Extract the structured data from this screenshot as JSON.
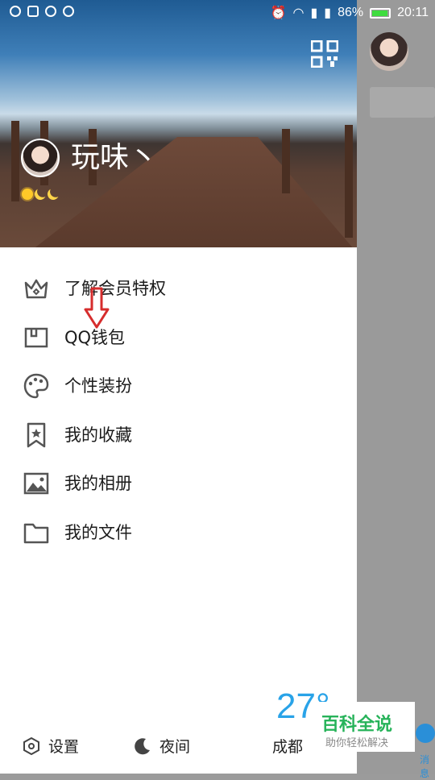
{
  "status_bar": {
    "battery": "86%",
    "time": "20:11",
    "battery_level": 0.86
  },
  "profile": {
    "nickname": "玩味丶"
  },
  "menu": {
    "items": [
      {
        "label": "了解会员特权",
        "icon": "crown-icon"
      },
      {
        "label": "QQ钱包",
        "icon": "wallet-icon"
      },
      {
        "label": "个性装扮",
        "icon": "palette-icon"
      },
      {
        "label": "我的收藏",
        "icon": "bookmark-star-icon"
      },
      {
        "label": "我的相册",
        "icon": "image-icon"
      },
      {
        "label": "我的文件",
        "icon": "folder-icon"
      }
    ]
  },
  "bottom_bar": {
    "settings": "设置",
    "night": "夜间",
    "city": "成都",
    "temperature": "27°"
  },
  "watermark": {
    "title": "百科全说",
    "subtitle": "助你轻松解决"
  },
  "behind": {
    "messages_label": "消息"
  },
  "colors": {
    "accent": "#29a3e8",
    "watermark_green": "#27b35a",
    "arrow_red": "#d62d2d"
  }
}
